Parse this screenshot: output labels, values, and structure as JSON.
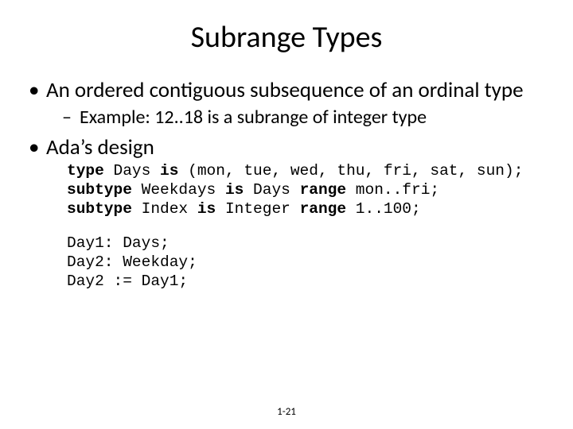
{
  "title": "Subrange Types",
  "bullets": {
    "b1": "An ordered contiguous subsequence of an ordinal type",
    "b1_sub": "Example: 12..18 is a subrange of integer type",
    "b2": "Ada’s design"
  },
  "code": {
    "kw_type": "type",
    "kw_is": "is",
    "kw_subtype": "subtype",
    "kw_range": "range",
    "l1_name": " Days ",
    "l1_body": " (mon, tue, wed, thu, fri, sat, sun);",
    "l2_seg1": " Weekdays ",
    "l2_seg2": " Days ",
    "l2_seg3": " mon..fri;",
    "l3_seg1": " Index ",
    "l3_seg2": " Integer ",
    "l3_seg3": " 1..100;",
    "l5": "Day1: Days;",
    "l6": "Day2: Weekday;",
    "l7": "Day2 := Day1;"
  },
  "footer": "1-21"
}
